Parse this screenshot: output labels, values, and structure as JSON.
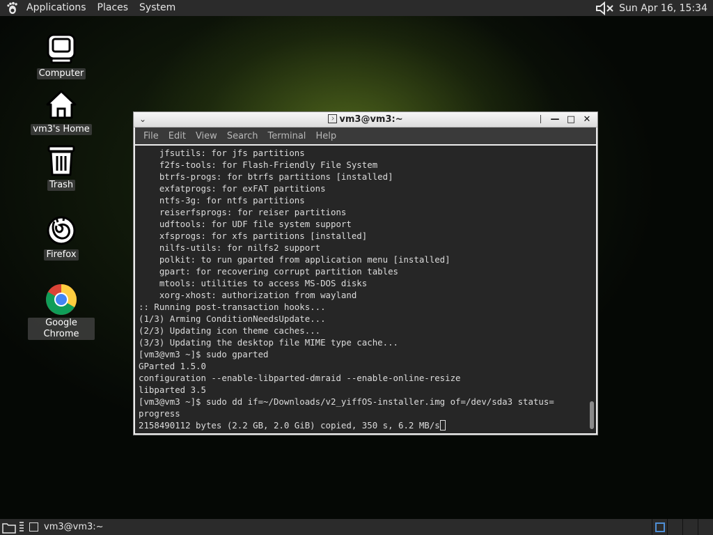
{
  "top_panel": {
    "menus": [
      "Applications",
      "Places",
      "System"
    ],
    "clock": "Sun Apr 16, 15:34"
  },
  "desktop": {
    "icons": [
      {
        "label": "Computer",
        "icon": "computer-icon"
      },
      {
        "label": "vm3's Home",
        "icon": "home-icon"
      },
      {
        "label": "Trash",
        "icon": "trash-icon"
      },
      {
        "label": "Firefox",
        "icon": "firefox-icon"
      },
      {
        "label": "Google Chrome",
        "icon": "chrome-icon"
      }
    ]
  },
  "window": {
    "title": "vm3@vm3:~",
    "menu": [
      "File",
      "Edit",
      "View",
      "Search",
      "Terminal",
      "Help"
    ],
    "terminal_lines": [
      "    jfsutils: for jfs partitions",
      "    f2fs-tools: for Flash-Friendly File System",
      "    btrfs-progs: for btrfs partitions [installed]",
      "    exfatprogs: for exFAT partitions",
      "    ntfs-3g: for ntfs partitions",
      "    reiserfsprogs: for reiser partitions",
      "    udftools: for UDF file system support",
      "    xfsprogs: for xfs partitions [installed]",
      "    nilfs-utils: for nilfs2 support",
      "    polkit: to run gparted from application menu [installed]",
      "    gpart: for recovering corrupt partition tables",
      "    mtools: utilities to access MS-DOS disks",
      "    xorg-xhost: authorization from wayland",
      ":: Running post-transaction hooks...",
      "(1/3) Arming ConditionNeedsUpdate...",
      "(2/3) Updating icon theme caches...",
      "(3/3) Updating the desktop file MIME type cache...",
      "[vm3@vm3 ~]$ sudo gparted",
      "GParted 1.5.0",
      "configuration --enable-libparted-dmraid --enable-online-resize",
      "libparted 3.5",
      "[vm3@vm3 ~]$ sudo dd if=~/Downloads/v2_yiffOS-installer.img of=/dev/sda3 status=",
      "progress"
    ],
    "last_line": "2158490112 bytes (2.2 GB, 2.0 GiB) copied, 350 s, 6.2 MB/s"
  },
  "bottom_panel": {
    "task_label": "vm3@vm3:~"
  },
  "colors": {
    "panel": "#2b2b2b",
    "terminal_bg": "#262626",
    "terminal_fg": "#dcdcdc",
    "workspace_accent": "#4f8fd6"
  }
}
